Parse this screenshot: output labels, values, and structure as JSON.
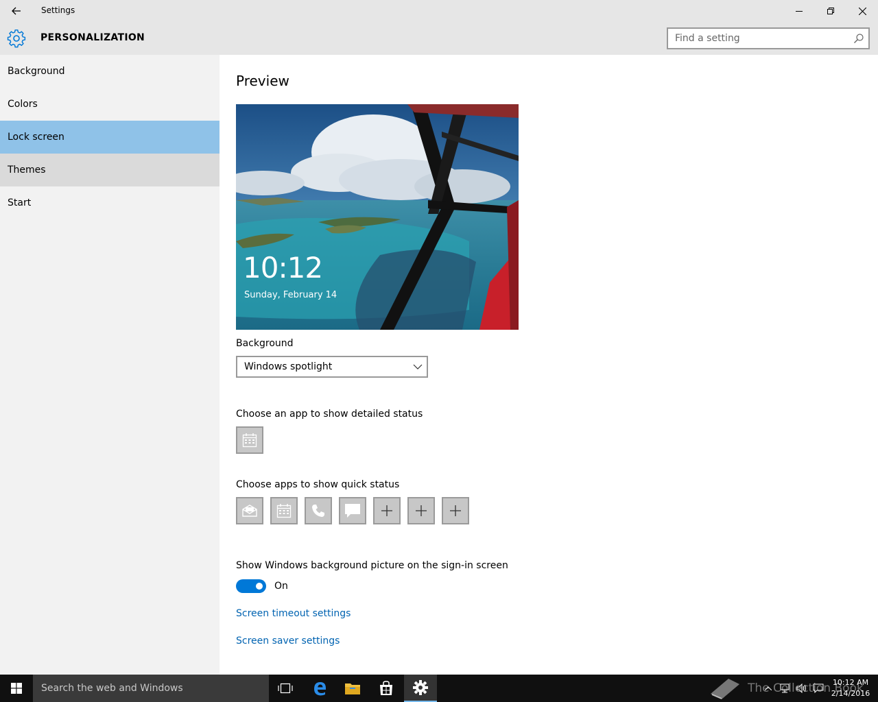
{
  "window": {
    "title": "Settings",
    "back_icon": "back-arrow-icon",
    "minimize_icon": "minimize-icon",
    "maximize_icon": "restore-icon",
    "close_icon": "close-icon"
  },
  "header": {
    "icon": "gear-icon",
    "title": "PERSONALIZATION",
    "search_placeholder": "Find a setting",
    "search_icon": "search-icon"
  },
  "sidebar": {
    "items": [
      {
        "label": "Background",
        "state": "normal"
      },
      {
        "label": "Colors",
        "state": "normal"
      },
      {
        "label": "Lock screen",
        "state": "selected"
      },
      {
        "label": "Themes",
        "state": "hover"
      },
      {
        "label": "Start",
        "state": "normal"
      }
    ]
  },
  "main": {
    "preview_title": "Preview",
    "preview_time": "10:12",
    "preview_date": "Sunday, February 14",
    "background_label": "Background",
    "background_value": "Windows spotlight",
    "detailed_status_label": "Choose an app to show detailed status",
    "detailed_status_app": "calendar-icon",
    "quick_status_label": "Choose apps to show quick status",
    "quick_status_apps": [
      "mail-icon",
      "calendar-icon",
      "phone-icon",
      "message-icon",
      "plus-icon",
      "plus-icon",
      "plus-icon"
    ],
    "signin_label": "Show Windows background picture on the sign-in screen",
    "signin_toggle": "On",
    "link_timeout": "Screen timeout settings",
    "link_screensaver": "Screen saver settings"
  },
  "taskbar": {
    "search_text": "Search the web and Windows",
    "clock_time": "10:12 AM",
    "clock_date": "2/14/2016",
    "watermark": "The Collection Book",
    "accent": "#76b9ed"
  },
  "colors": {
    "accent": "#0078d7",
    "selected_nav": "#8fc2e8",
    "link": "#0063b1"
  }
}
